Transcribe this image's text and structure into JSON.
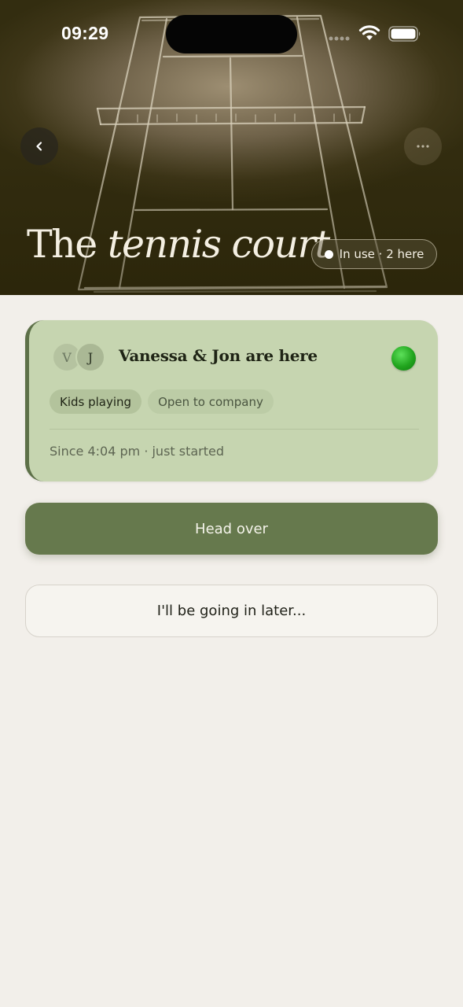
{
  "status_bar": {
    "time": "09:29"
  },
  "header": {
    "title_plain": "The",
    "title_italic": "tennis court",
    "status_label": "In use · 2 here"
  },
  "icons": {
    "back": "chevron-left-icon",
    "more": "more-horizontal-icon",
    "wifi": "wifi-icon",
    "battery": "battery-icon",
    "signal": "signal-icon"
  },
  "card": {
    "avatars": [
      "V",
      "J"
    ],
    "title": "Vanessa & Jon are here",
    "tags": [
      "Kids playing",
      "Open to company"
    ],
    "since": "Since 4:04 pm · just started",
    "live_color": "#22a51f"
  },
  "actions": {
    "primary": "Head over",
    "secondary": "I'll be going in later..."
  },
  "colors": {
    "accent": "#66794d",
    "card_bg": "#c6d5b0",
    "page_bg": "#f2efea"
  }
}
